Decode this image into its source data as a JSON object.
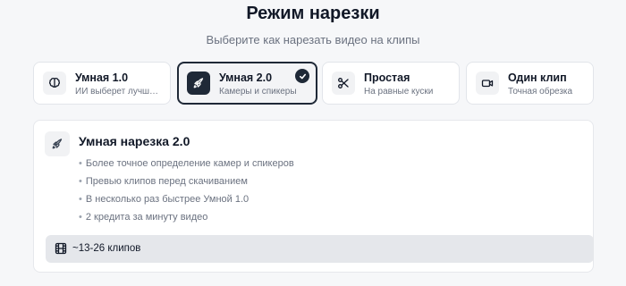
{
  "header": {
    "title": "Режим нарезки",
    "subtitle": "Выберите как нарезать видео на клипы"
  },
  "options": [
    {
      "name": "Умная 1.0",
      "desc": "ИИ выберет лучшие моменты",
      "icon": "brain-icon",
      "selected": false
    },
    {
      "name": "Умная 2.0",
      "desc": "Камеры и спикеры",
      "icon": "rocket-icon",
      "selected": true
    },
    {
      "name": "Простая",
      "desc": "На равные куски",
      "icon": "scissors-icon",
      "selected": false
    },
    {
      "name": "Один клип",
      "desc": "Точная обрезка",
      "icon": "video-camera-icon",
      "selected": false
    }
  ],
  "details": {
    "title": "Умная нарезка 2.0",
    "icon": "rocket-icon",
    "features": [
      "Более точное определение камер и спикеров",
      "Превью клипов перед скачиванием",
      "В несколько раз быстрее Умной 1.0",
      "2 кредита за минуту видео"
    ],
    "estimate": "~13-26 клипов",
    "estimate_icon": "film-icon"
  },
  "colors": {
    "accent": "#1f2937",
    "background": "#f6f7f9",
    "muted_text": "#6b7280"
  }
}
